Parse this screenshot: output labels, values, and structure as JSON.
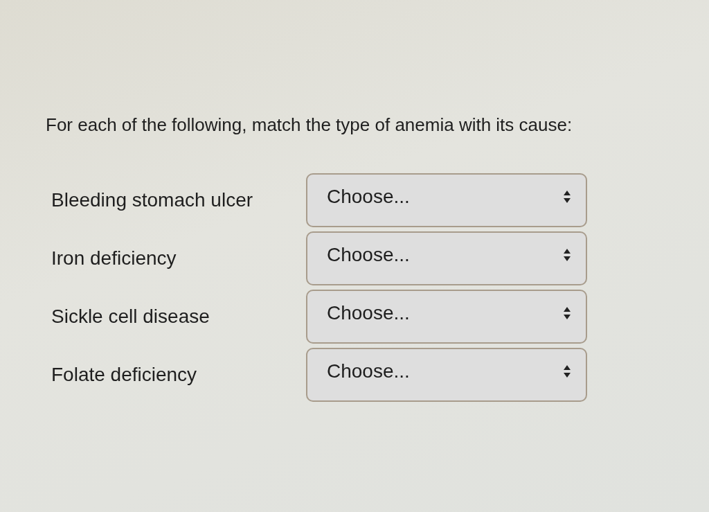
{
  "prompt": "For each of the following, match the type of anemia with its cause:",
  "rows": [
    {
      "label": "Bleeding stomach ulcer",
      "select": {
        "value": "Choose..."
      }
    },
    {
      "label": "Iron deficiency",
      "select": {
        "value": "Choose..."
      }
    },
    {
      "label": "Sickle cell disease",
      "select": {
        "value": "Choose..."
      }
    },
    {
      "label": "Folate deficiency",
      "select": {
        "value": "Choose..."
      }
    }
  ]
}
